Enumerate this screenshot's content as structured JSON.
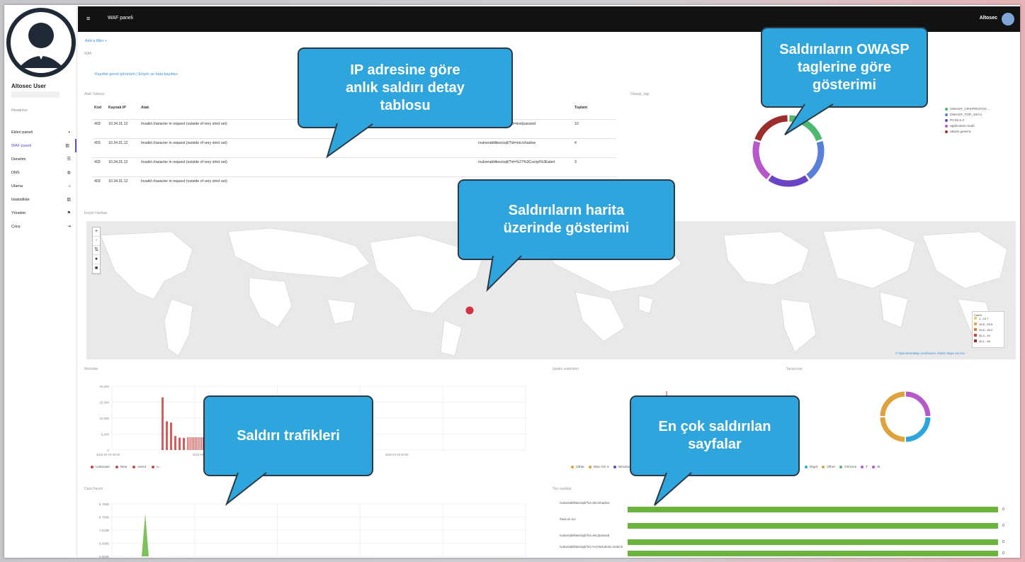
{
  "sidebar": {
    "username": "Altosec User",
    "small_link": "Hesabınız",
    "items": [
      {
        "label": "Ekleri paneli",
        "icon": "◐",
        "active": false
      },
      {
        "label": "WAF paneli",
        "icon": "▥",
        "active": true
      },
      {
        "label": "Denetim",
        "icon": "☰",
        "active": false
      },
      {
        "label": "DNS",
        "icon": "◍",
        "active": false
      },
      {
        "label": "Ulama",
        "icon": "⌂",
        "active": false
      },
      {
        "label": "Istatistikler",
        "icon": "▥",
        "active": false
      },
      {
        "label": "Yönetim",
        "icon": "⚑",
        "active": false
      },
      {
        "label": "Çıkış",
        "icon": "⇥",
        "active": false
      }
    ]
  },
  "topbar": {
    "menu_icon": "≡",
    "title": "WAF paneli",
    "user": "Altosec"
  },
  "page": {
    "add_link": "Add a filter +",
    "section_label": "WAF",
    "links": "Kayıtlar genel görünüm | Erişim ve hata kayıtları",
    "table_label": "Atak Tablosu",
    "owasp_label": "Owasp_tagı",
    "map_label": "Erişim Haritası",
    "traffic_label": "Metodlar",
    "os_label": "İşletim sistemleri",
    "browser_label": "Tarayıcılar",
    "data_label": "Data Hacmi",
    "top_label": "Top sayfalar"
  },
  "table": {
    "headers": [
      "Kod",
      "Kaynak IP",
      "Atak",
      "Hedef",
      "Toplam"
    ],
    "rows": [
      {
        "code": "403",
        "ip": "10.34.31.12",
        "msg": "Invalid character in request (outside of very strict set)",
        "path": "/vulnerabilities/sqli/?id=test/passwd",
        "total": "10"
      },
      {
        "code": "403",
        "ip": "10.34.31.12",
        "msg": "Invalid character in request (outside of very strict set)",
        "path": "/vulnerabilities/sqli/?id=/etc/shadow",
        "total": "4"
      },
      {
        "code": "403",
        "ip": "10.34.31.12",
        "msg": "Invalid character in request (outside of very strict set)",
        "path": "/vulnerabilities/sqli/?id=%27%3Cscript%3Ealert",
        "total": "3"
      },
      {
        "code": "403",
        "ip": "10.34.31.12",
        "msg": "Invalid character in request (outside of very strict set)",
        "path": "/vulnerabilities/sqli/",
        "total": "1"
      }
    ]
  },
  "owasp_legend": [
    {
      "label": "OWASP_CRS/PROTOC...",
      "color": "#4fb870"
    },
    {
      "label": "OWASP_TOP_10/A1",
      "color": "#5a7fd8"
    },
    {
      "label": "PCI/6.5.2",
      "color": "#6a43c6"
    },
    {
      "label": "application-multi",
      "color": "#b558c9"
    },
    {
      "label": "attack-generic",
      "color": "#9b2d2d"
    }
  ],
  "map": {
    "controls": [
      "+",
      "-",
      "⇅",
      "●",
      "■"
    ],
    "legend_title": "Count",
    "legend_items": [
      "1 - 10.7",
      "10.8 - 20.5",
      "20.5 - 30.2",
      "30.3 - 40",
      "40.1 - 50"
    ],
    "attribution": "© OpenStreetMap contributors,",
    "attribution_link": "Elastic Maps Service"
  },
  "chart_data": [
    {
      "type": "bar",
      "title": "Metodlar",
      "y_ticks": [
        "20,000",
        "15,000",
        "10,000",
        "5,000",
        "0"
      ],
      "x_ticks": [
        "2018-04-19 00:00",
        "2018-04-26 00:00",
        "2018-04-28 00:00",
        "2018-04-29 00:00"
      ],
      "legend": [
        {
          "name": "Unknown",
          "color": "#c94545"
        },
        {
          "name": "beta",
          "color": "#c94545"
        },
        {
          "name": "event",
          "color": "#c94545"
        },
        {
          "name": "u...",
          "color": "#c94545"
        }
      ],
      "values": [
        16500,
        9000,
        8600,
        4400,
        3900,
        3800
      ]
    },
    {
      "type": "bar",
      "title": "Data Hacmi",
      "y_ticks": [
        "9,766B",
        "8,789B",
        "7,813B",
        "6,836B",
        "5,859B"
      ],
      "values": [
        9000
      ]
    },
    {
      "type": "bar",
      "title": "Top sayfalar",
      "categories": [
        "/vulnerabilities/sqli/?id=/etc/shadow",
        "/favicon.ico",
        "/vulnerabilities/sqli/?id=/etc/passwd",
        "/vulnerabilities/sqli/?id=%27&Submit=Submit"
      ],
      "values": [
        0,
        0,
        0,
        0
      ]
    }
  ],
  "os_legend": [
    {
      "label": "Other",
      "color": "#e0a23c"
    },
    {
      "label": "Mac OS X",
      "color": "#e0a23c"
    },
    {
      "label": "Windows",
      "color": "#6a43c6"
    },
    {
      "label": "",
      "color": "#3a6fc7"
    }
  ],
  "browser_legend": [
    {
      "label": "Wget",
      "color": "#2ea6dd"
    },
    {
      "label": "Other",
      "color": "#e0a23c"
    },
    {
      "label": "Chrome",
      "color": "#4fb870"
    },
    {
      "label": "T",
      "color": "#b558c9"
    },
    {
      "label": "IE",
      "color": "#b558c9"
    }
  ],
  "callouts": {
    "table": "IP adresine göre anlık saldırı detay tablosu",
    "owasp": "Saldırıların OWASP taglerine göre gösterimi",
    "map": "Saldırıların harita üzerinde gösterimi",
    "traffic": "Saldırı trafikleri",
    "pages": "En çok saldırılan sayfalar"
  },
  "colors": {
    "accent": "#2ea6dd",
    "topbar": "#121212",
    "bar": "#6db33f",
    "map_marker": "#d0343f",
    "active_nav": "#6b49c9"
  }
}
